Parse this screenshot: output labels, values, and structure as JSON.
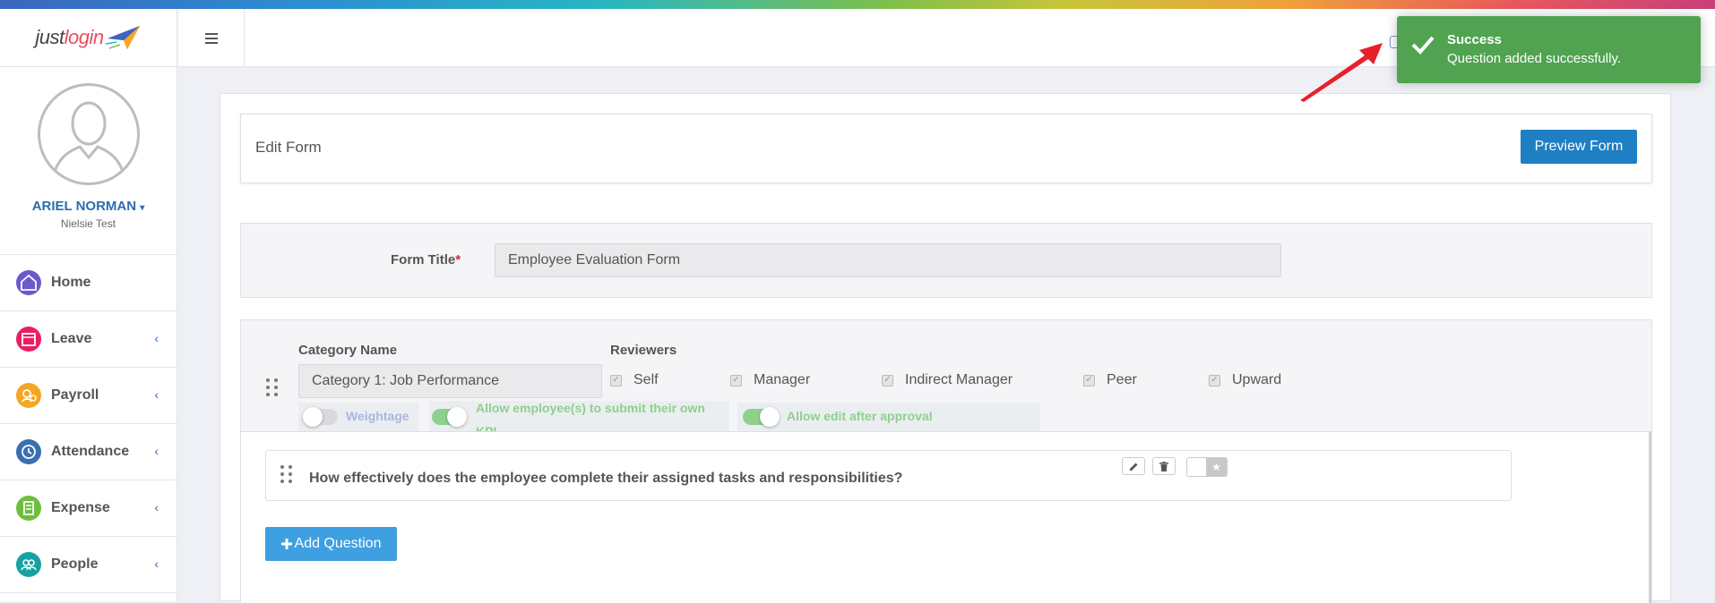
{
  "app": {
    "logo_prefix": "just",
    "logo_accent": "login"
  },
  "colors": {
    "primary": "#1f7fc3",
    "success": "#51a351",
    "toggle_green": "#8ed08e",
    "required": "#d9262a"
  },
  "user": {
    "name": "ARIEL NORMAN",
    "company": "Nielsie Test"
  },
  "sidebar": {
    "items": [
      {
        "label": "Home",
        "icon": "home-icon",
        "color": "#6a5acd",
        "has_arrow": false
      },
      {
        "label": "Leave",
        "icon": "calendar-icon",
        "color": "#e91e63",
        "has_arrow": true
      },
      {
        "label": "Payroll",
        "icon": "money-icon",
        "color": "#f5a623",
        "has_arrow": true
      },
      {
        "label": "Attendance",
        "icon": "clock-icon",
        "color": "#3a6fb0",
        "has_arrow": true
      },
      {
        "label": "Expense",
        "icon": "receipt-icon",
        "color": "#6cbf3e",
        "has_arrow": true
      },
      {
        "label": "People",
        "icon": "people-icon",
        "color": "#17a2a2",
        "has_arrow": true
      }
    ],
    "arrow_glyph": "‹"
  },
  "header": {
    "edit_title": "Edit Form",
    "preview_button": "Preview Form"
  },
  "form": {
    "title_label": "Form Title",
    "required_mark": "*",
    "title_value": "Employee Evaluation Form"
  },
  "category": {
    "name_label": "Category Name",
    "reviewers_label": "Reviewers",
    "name_value": "Category 1: Job Performance",
    "reviewers": [
      "Self",
      "Manager",
      "Indirect Manager",
      "Peer",
      "Upward"
    ],
    "toggles": {
      "weightage": {
        "label": "Weightage",
        "on": false
      },
      "allow_kpi": {
        "label_line1": "Allow employee(s) to submit their own",
        "label_line2": "KPI",
        "on": true
      },
      "allow_edit": {
        "label": "Allow edit after approval",
        "on": true
      }
    }
  },
  "questions": [
    {
      "text": "How effectively does the employee complete their assigned tasks and responsibilities?"
    }
  ],
  "add_question_button": "Add Question",
  "toast": {
    "title": "Success",
    "message": "Question added successfully."
  }
}
